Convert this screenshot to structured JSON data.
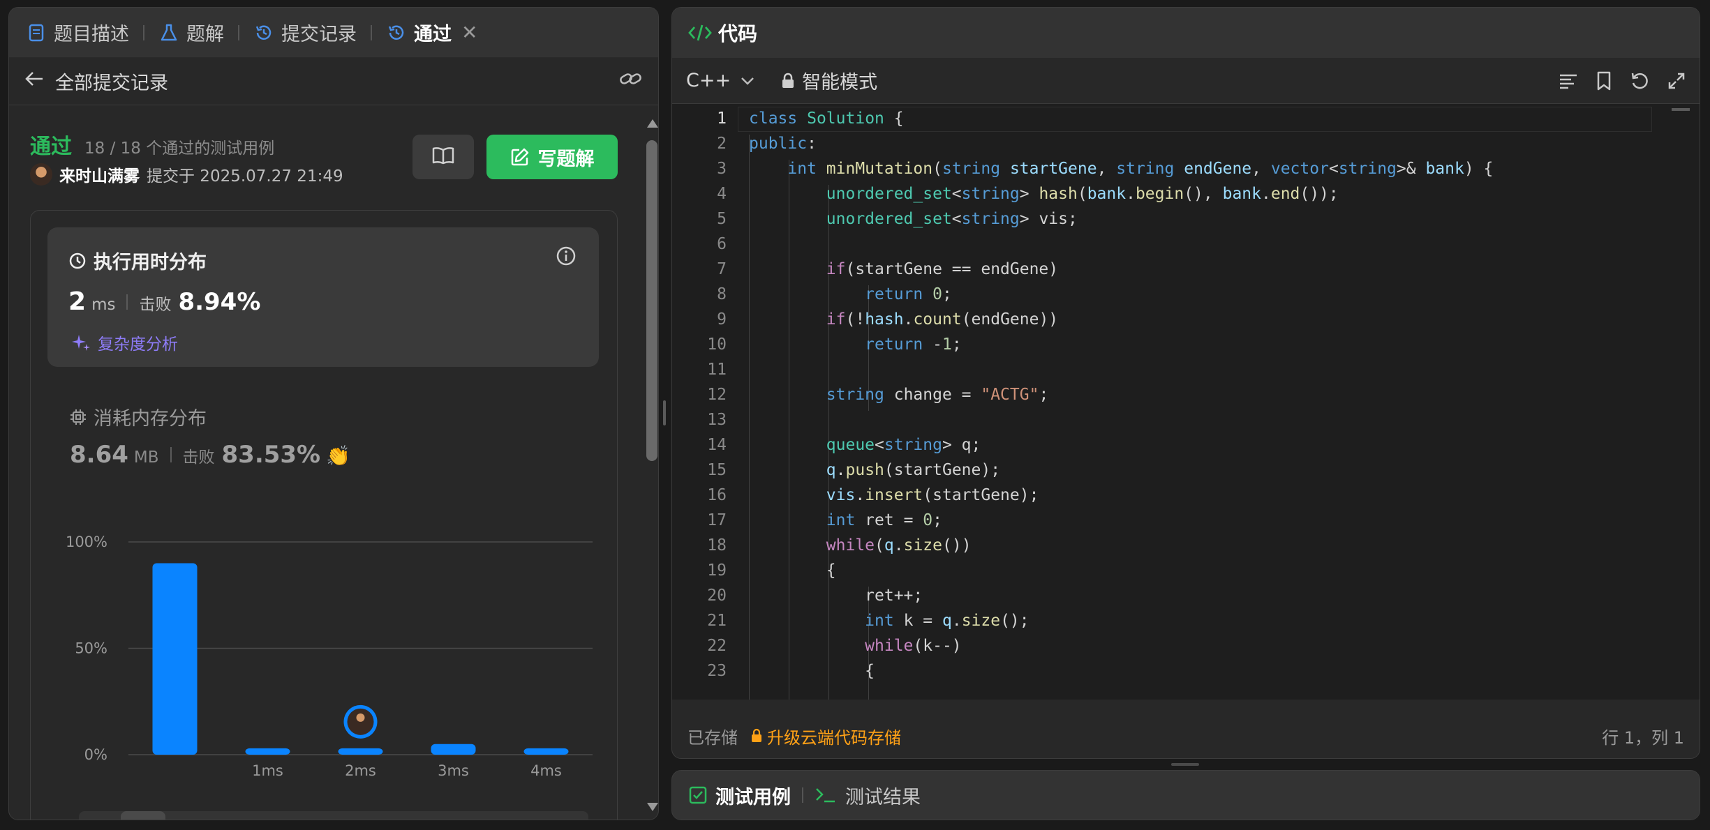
{
  "left_tabs": [
    {
      "label": "题目描述"
    },
    {
      "label": "题解"
    },
    {
      "label": "提交记录"
    },
    {
      "label": "通过"
    }
  ],
  "subheader": {
    "title": "全部提交记录"
  },
  "submission": {
    "status": "通过",
    "cases": "18 / 18 个通过的测试用例",
    "author": "来时山满雾",
    "submitted": "提交于 2025.07.27 21:49",
    "write_solution": "写题解"
  },
  "runtime": {
    "title": "执行用时分布",
    "value": "2",
    "unit": "ms",
    "beat_label": "击败",
    "beat": "8.94%",
    "complexity": "复杂度分析"
  },
  "memory": {
    "title": "消耗内存分布",
    "value": "8.64",
    "unit": "MB",
    "beat_label": "击败",
    "beat": "83.53%"
  },
  "chart_data": {
    "type": "bar",
    "categories": [
      "",
      "1ms",
      "2ms",
      "3ms",
      "4ms"
    ],
    "values": [
      90,
      3,
      3,
      5,
      3
    ],
    "yticks": [
      "100%",
      "50%",
      "0%"
    ],
    "ylim": [
      0,
      100
    ],
    "highlight_index": 2,
    "color": "#0a84ff"
  },
  "editor": {
    "title": "代码",
    "language": "C++",
    "mode": "智能模式",
    "saved": "已存储",
    "upgrade": "升级云端代码存储",
    "cursor": "行 1，列 1"
  },
  "code_lines": [
    "class Solution {",
    "public:",
    "    int minMutation(string startGene, string endGene, vector<string>& bank) {",
    "        unordered_set<string> hash(bank.begin(), bank.end());",
    "        unordered_set<string> vis;",
    "",
    "        if(startGene == endGene)",
    "            return 0;",
    "        if(!hash.count(endGene))",
    "            return -1;",
    "",
    "        string change = \"ACTG\";",
    "",
    "        queue<string> q;",
    "        q.push(startGene);",
    "        vis.insert(startGene);",
    "        int ret = 0;",
    "        while(q.size())",
    "        {",
    "            ret++;",
    "            int k = q.size();",
    "            while(k--)",
    "            {"
  ],
  "bottom_tabs": [
    {
      "label": "测试用例"
    },
    {
      "label": "测试结果"
    }
  ],
  "colors": {
    "accent": "#2cbb5d",
    "blue": "#0a84ff",
    "orange": "#ffa116",
    "purple": "#8e7cf8"
  }
}
